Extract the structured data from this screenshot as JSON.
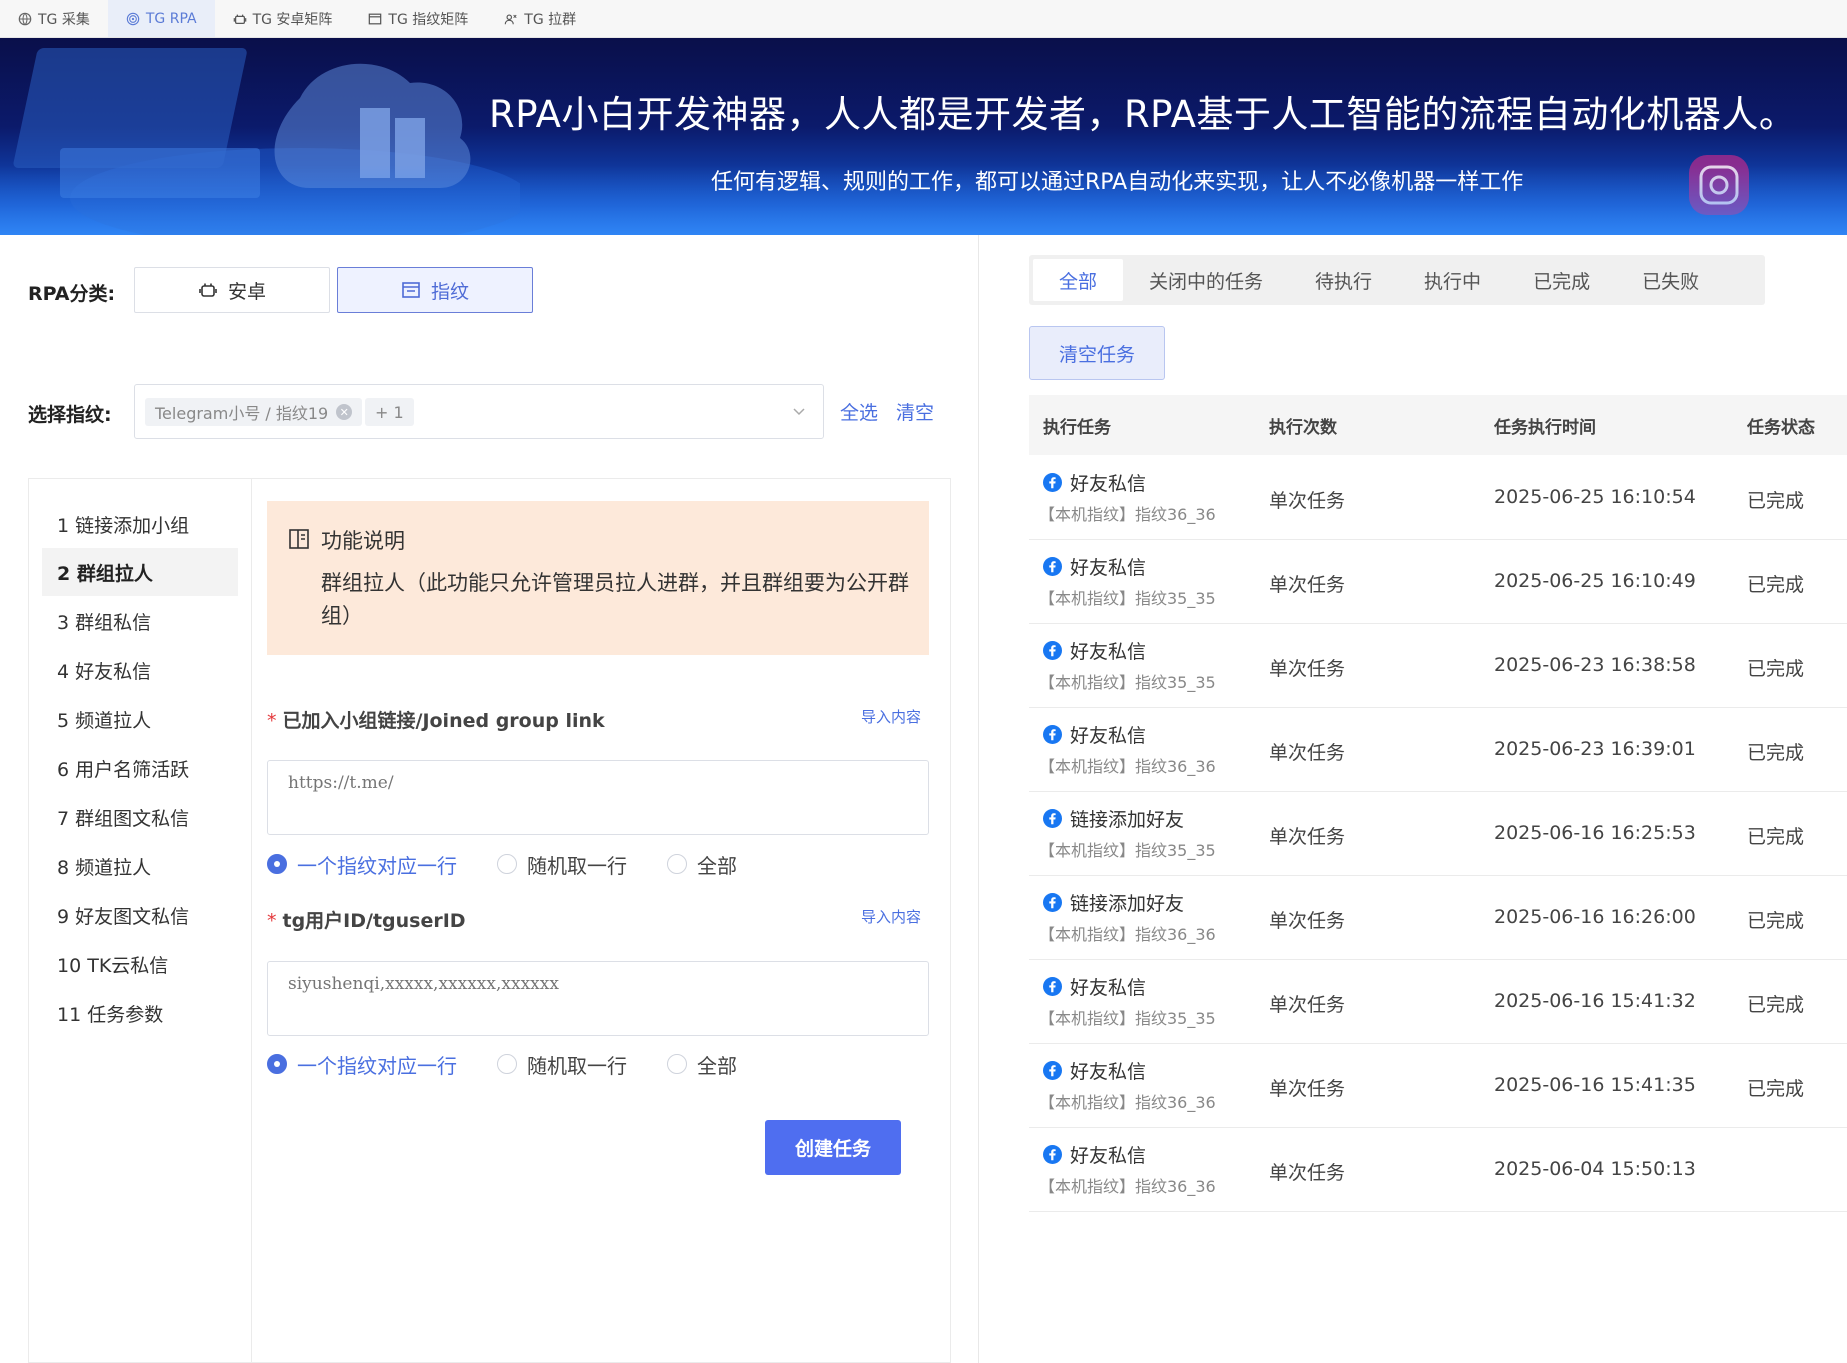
{
  "topnav": {
    "tabs": [
      {
        "label": "TG 采集",
        "icon": "globe-icon"
      },
      {
        "label": "TG RPA",
        "icon": "fingerprint-icon",
        "active": true
      },
      {
        "label": "TG 安卓矩阵",
        "icon": "android-icon"
      },
      {
        "label": "TG 指纹矩阵",
        "icon": "window-icon"
      },
      {
        "label": "TG 拉群",
        "icon": "group-icon"
      }
    ]
  },
  "banner": {
    "title": "RPA小白开发神器，人人都是开发者，RPA基于人工智能的流程自动化机器人。",
    "subtitle": "任何有逻辑、规则的工作，都可以通过RPA自动化来实现，让人不必像机器一样工作"
  },
  "form": {
    "category_label": "RPA分类:",
    "category_options": [
      {
        "label": "安卓",
        "icon": "android-icon"
      },
      {
        "label": "指纹",
        "icon": "window-icon",
        "active": true
      }
    ],
    "fingerprint_label": "选择指纹:",
    "selected_tag": "Telegram小号 / 指纹19",
    "more_tag": "+ 1",
    "select_all": "全选",
    "clear": "清空"
  },
  "menu": {
    "items": [
      "1 链接添加小组",
      "2 群组拉人",
      "3 群组私信",
      "4 好友私信",
      "5 频道拉人",
      "6 用户名筛活跃",
      "7 群组图文私信",
      "8 频道拉人",
      "9 好友图文私信",
      "10 TK云私信",
      "11 任务参数"
    ],
    "active_index": 1
  },
  "info": {
    "title": "功能说明",
    "desc": "群组拉人（此功能只允许管理员拉人进群，并且群组要为公开群组）"
  },
  "fields": {
    "group_link": {
      "label": "已加入小组链接/Joined group link",
      "import": "导入内容",
      "placeholder": "https://t.me/",
      "radios": [
        "一个指纹对应一行",
        "随机取一行",
        "全部"
      ]
    },
    "user_id": {
      "label": "tg用户ID/tguserID",
      "import": "导入内容",
      "placeholder": "siyushenqi,xxxxx,xxxxxx,xxxxxx",
      "radios": [
        "一个指纹对应一行",
        "随机取一行",
        "全部"
      ]
    },
    "create_button": "创建任务"
  },
  "status_tabs": [
    "全部",
    "关闭中的任务",
    "待执行",
    "执行中",
    "已完成",
    "已失败"
  ],
  "clear_tasks": "清空任务",
  "table": {
    "headers": [
      "执行任务",
      "执行次数",
      "任务执行时间",
      "任务状态"
    ],
    "rows": [
      {
        "task": "好友私信",
        "device": "【本机指纹】指纹36_36",
        "count": "单次任务",
        "time": "2025-06-25 16:10:54",
        "status": "已完成"
      },
      {
        "task": "好友私信",
        "device": "【本机指纹】指纹35_35",
        "count": "单次任务",
        "time": "2025-06-25 16:10:49",
        "status": "已完成"
      },
      {
        "task": "好友私信",
        "device": "【本机指纹】指纹35_35",
        "count": "单次任务",
        "time": "2025-06-23 16:38:58",
        "status": "已完成"
      },
      {
        "task": "好友私信",
        "device": "【本机指纹】指纹36_36",
        "count": "单次任务",
        "time": "2025-06-23 16:39:01",
        "status": "已完成"
      },
      {
        "task": "链接添加好友",
        "device": "【本机指纹】指纹35_35",
        "count": "单次任务",
        "time": "2025-06-16 16:25:53",
        "status": "已完成"
      },
      {
        "task": "链接添加好友",
        "device": "【本机指纹】指纹36_36",
        "count": "单次任务",
        "time": "2025-06-16 16:26:00",
        "status": "已完成"
      },
      {
        "task": "好友私信",
        "device": "【本机指纹】指纹35_35",
        "count": "单次任务",
        "time": "2025-06-16 15:41:32",
        "status": "已完成"
      },
      {
        "task": "好友私信",
        "device": "【本机指纹】指纹36_36",
        "count": "单次任务",
        "time": "2025-06-16 15:41:35",
        "status": "已完成"
      },
      {
        "task": "好友私信",
        "device": "【本机指纹】指纹36_36",
        "count": "单次任务",
        "time": "2025-06-04 15:50:13",
        "status": ""
      }
    ]
  },
  "colors": {
    "accent": "#4a6fe0",
    "button": "#4f6ef0",
    "info_bg": "#fde9da",
    "banner_dark": "#0a0f4a"
  }
}
